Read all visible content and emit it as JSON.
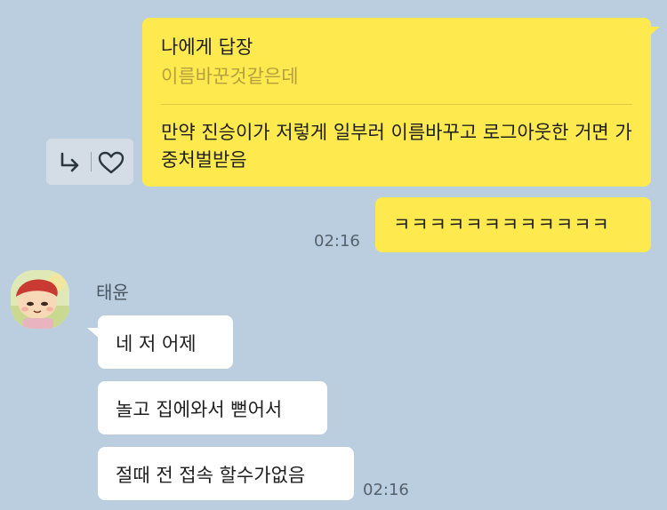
{
  "reply_message": {
    "reply_to_label": "나에게 답장",
    "quoted_text": "이름바꾼것같은데",
    "body": "만약 진승이가 저렇게 일부러 이름바꾸고 로그아웃한 거면 가중처벌받음"
  },
  "reaction_bar": {
    "reply_icon": "reply-arrow-icon",
    "heart_icon": "heart-icon"
  },
  "my_message_2": {
    "text": "ㅋㅋㅋㅋㅋㅋㅋㅋㅋㅋㅋㅋ",
    "time": "02:16"
  },
  "sender": {
    "name": "태윤"
  },
  "their_messages": [
    {
      "text": "네 저 어제"
    },
    {
      "text": "놀고 집에와서 뻗어서"
    },
    {
      "text": "절때 전 접속 할수가없음"
    }
  ],
  "their_time": "02:16",
  "colors": {
    "background": "#bacee0",
    "my_bubble": "#fee94e",
    "their_bubble": "#ffffff"
  }
}
